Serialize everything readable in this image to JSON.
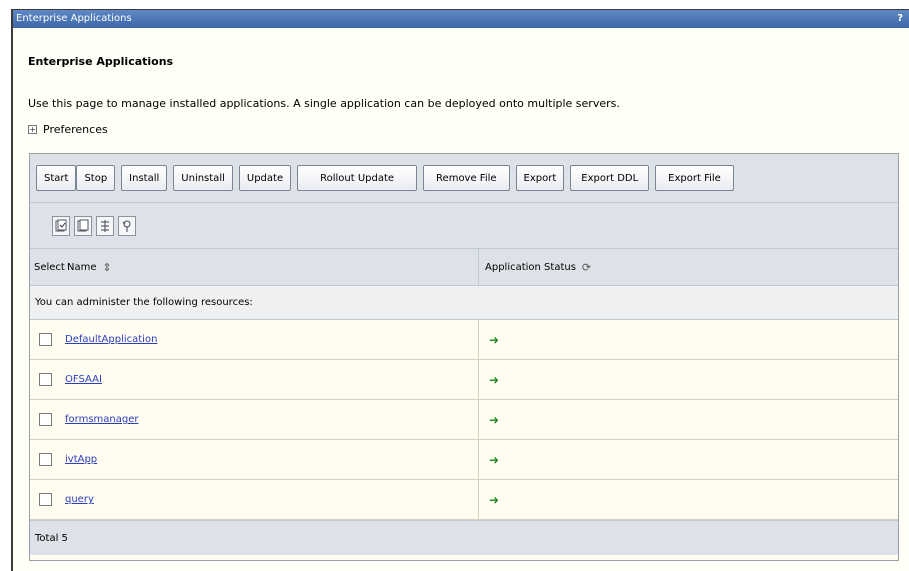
{
  "window": {
    "title": "Enterprise Applications",
    "help": "?"
  },
  "page": {
    "heading": "Enterprise Applications",
    "description": "Use this page to manage installed applications. A single application can be deployed onto multiple servers.",
    "preferences": "Preferences"
  },
  "toolbar": {
    "buttons": [
      "Start",
      "Stop",
      "Install",
      "Uninstall",
      "Update",
      "Rollout Update",
      "Remove File",
      "Export",
      "Export DDL",
      "Export File"
    ]
  },
  "icons": [
    "select-all-icon",
    "deselect-all-icon",
    "filter-icon",
    "clear-filter-icon"
  ],
  "table": {
    "columns": {
      "select": "Select",
      "name": "Name",
      "status": "Application Status"
    },
    "info": "You can administer the following resources:",
    "rows": [
      {
        "name": "DefaultApplication",
        "status": "started"
      },
      {
        "name": "OFSAAI",
        "status": "started"
      },
      {
        "name": "formsmanager",
        "status": "started"
      },
      {
        "name": "ivtApp",
        "status": "started"
      },
      {
        "name": "query",
        "status": "started"
      }
    ],
    "total": "Total 5"
  },
  "colors": {
    "status_started": "#2c8a2c",
    "link": "#2a3ec0",
    "titlebar": "#4a74b5"
  }
}
